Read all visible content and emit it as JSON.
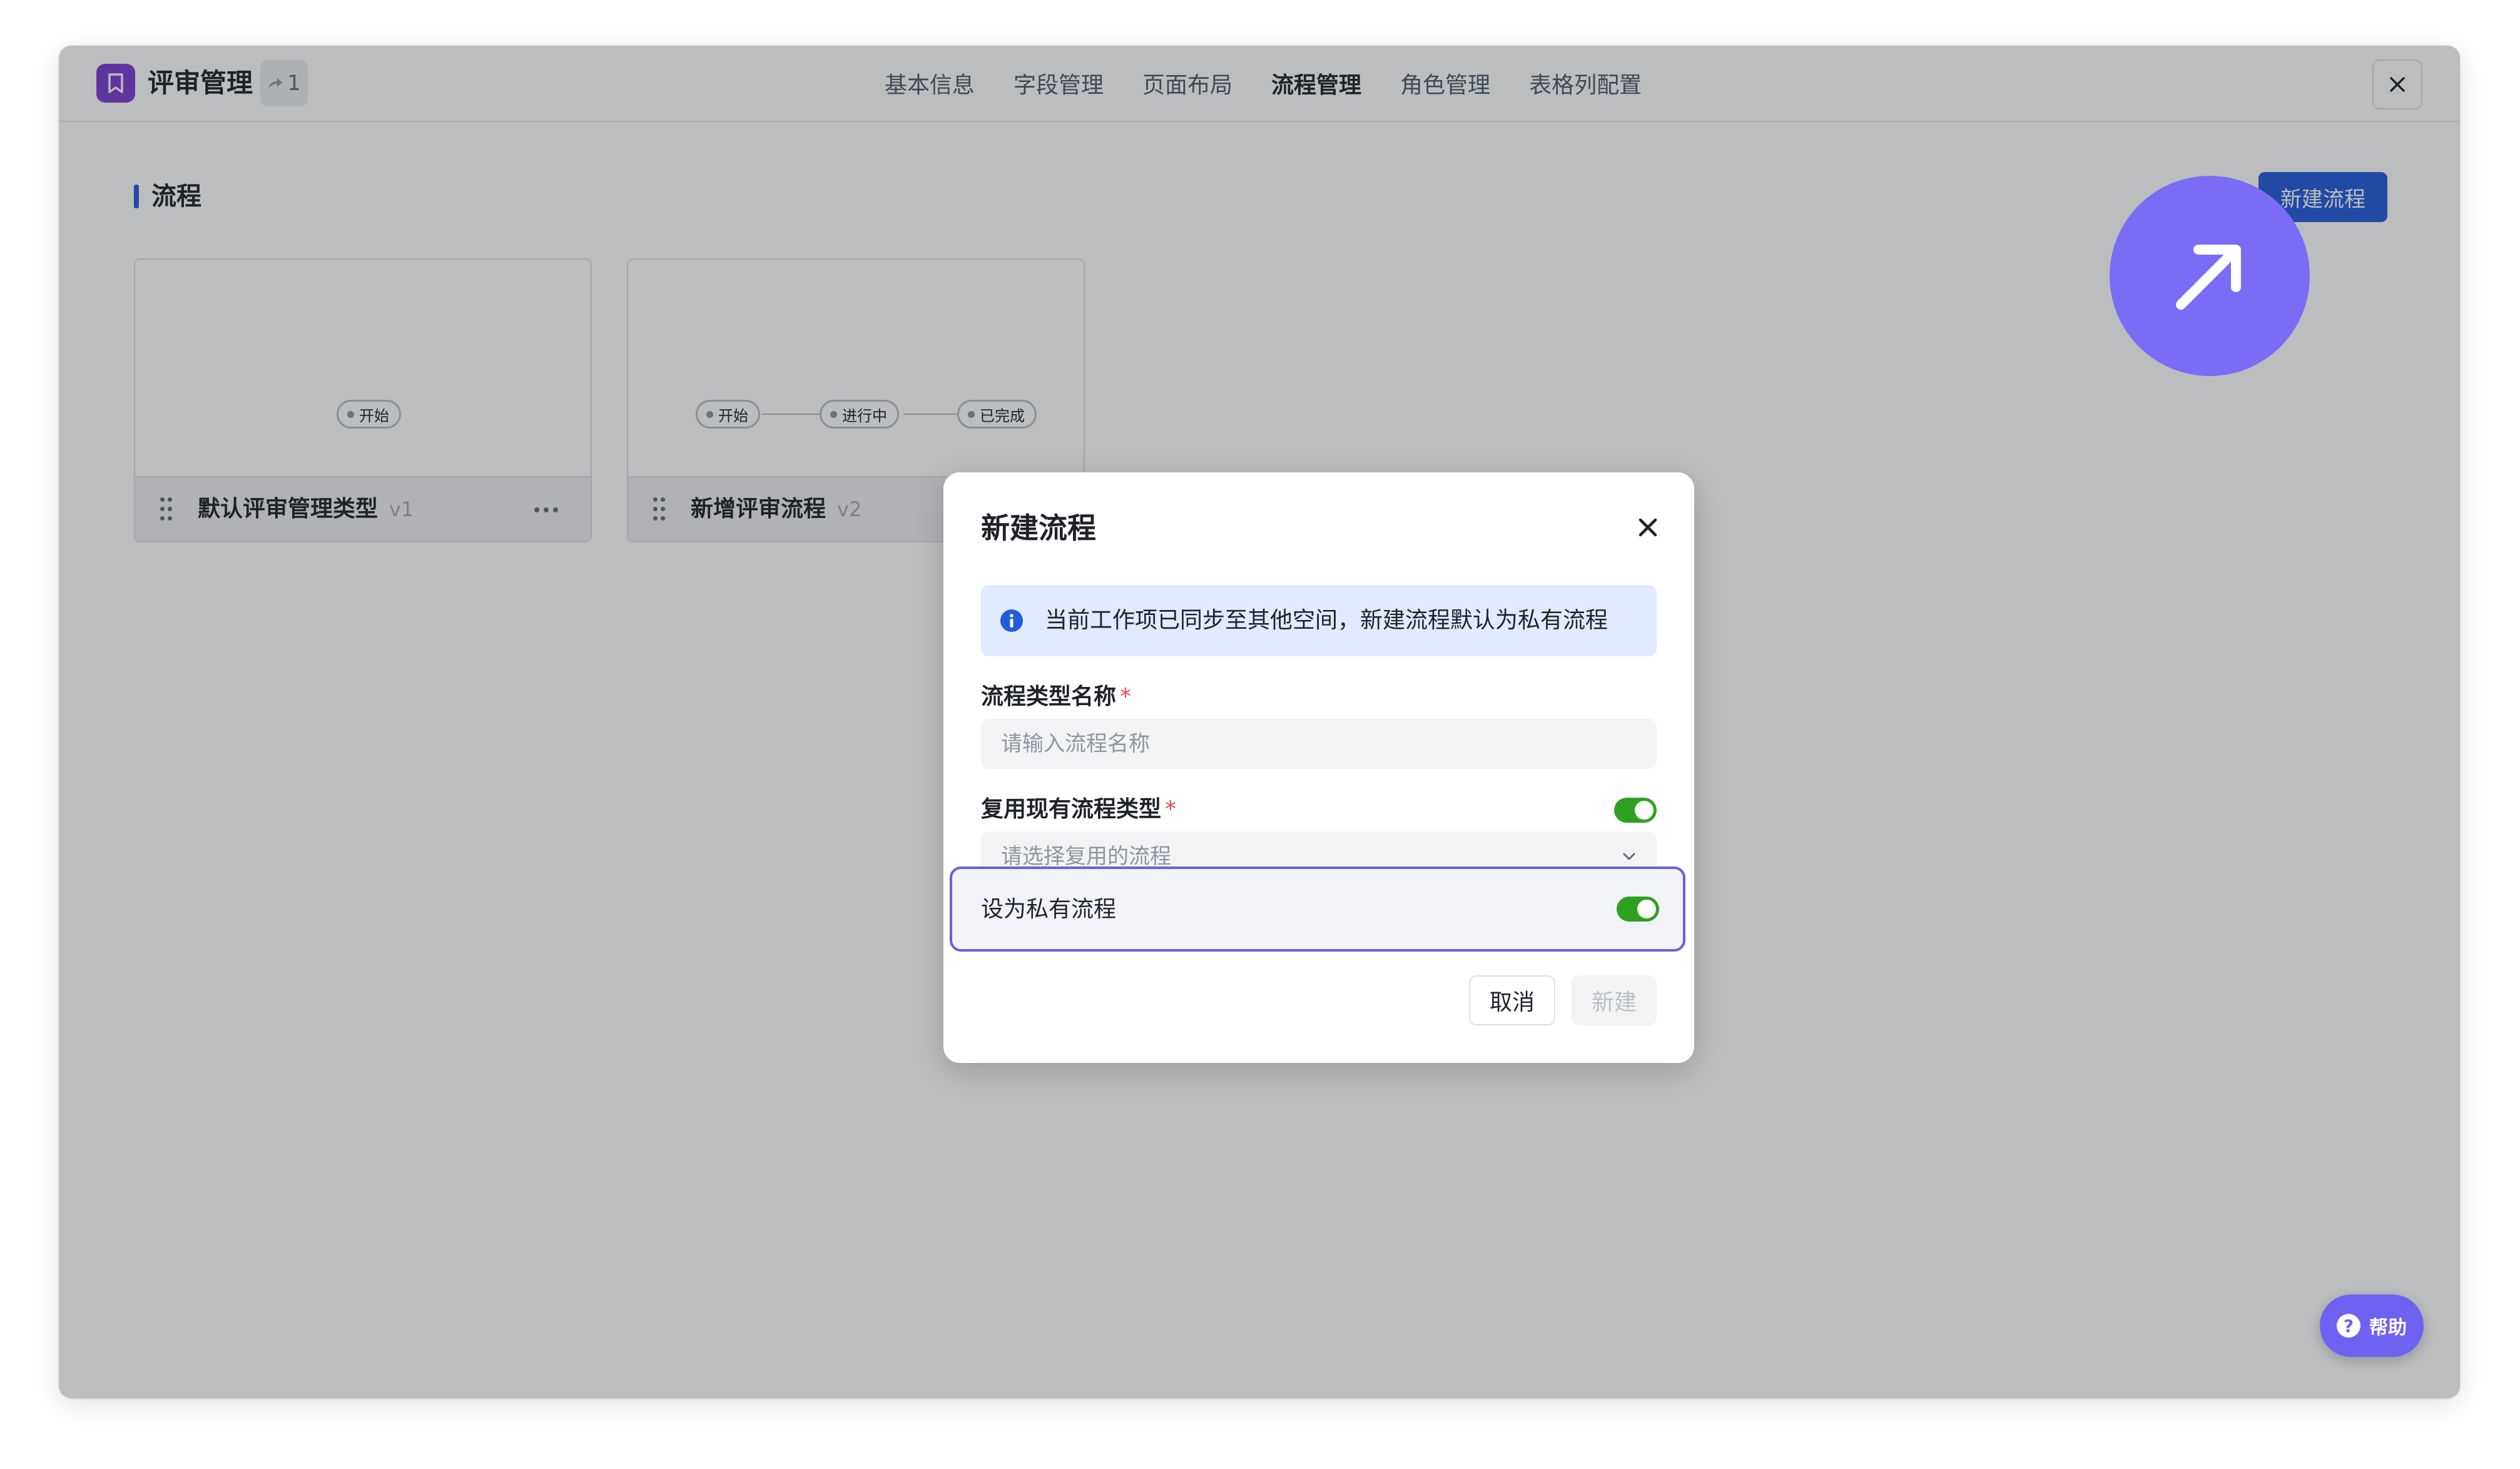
{
  "header": {
    "app_title": "评审管理",
    "link_count": "1",
    "tabs": [
      {
        "label": "基本信息"
      },
      {
        "label": "字段管理"
      },
      {
        "label": "页面布局"
      },
      {
        "label": "流程管理",
        "active": true
      },
      {
        "label": "角色管理"
      },
      {
        "label": "表格列配置"
      }
    ]
  },
  "main": {
    "section_title": "流程",
    "new_flow_button": "新建流程",
    "cards": [
      {
        "name": "默认评审管理类型",
        "version": "v1",
        "nodes": [
          "开始"
        ]
      },
      {
        "name": "新增评审流程",
        "version": "v2",
        "nodes": [
          "开始",
          "进行中",
          "已完成"
        ]
      }
    ]
  },
  "dialog": {
    "title": "新建流程",
    "info_text": "当前工作项已同步至其他空间，新建流程默认为私有流程",
    "name_label": "流程类型名称",
    "name_placeholder": "请输入流程名称",
    "reuse_label": "复用现有流程类型",
    "reuse_toggle_on": true,
    "reuse_placeholder": "请选择复用的流程",
    "private_label": "设为私有流程",
    "private_toggle_on": true,
    "cancel_button": "取消",
    "create_button": "新建"
  },
  "help": {
    "label": "帮助"
  },
  "colors": {
    "primary": "#245bdb",
    "toggle_on": "#2ea121",
    "highlight": "#6b5ee0",
    "app_icon": "#7d3cd1",
    "required": "#f54a45"
  }
}
